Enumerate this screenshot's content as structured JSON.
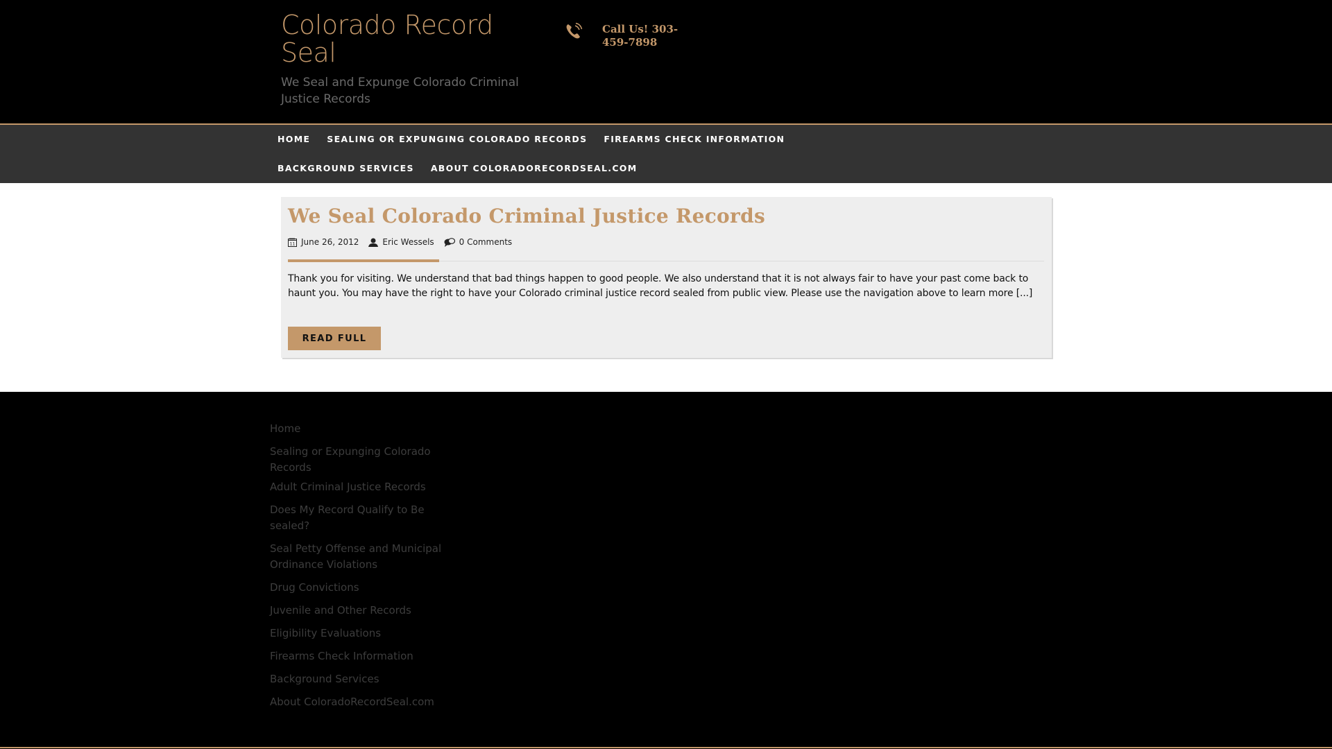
{
  "header": {
    "site_title": "Colorado Record Seal",
    "tagline": "We Seal and Expunge Colorado Criminal Justice Records",
    "phone_label": "Call Us! 303-459-7898",
    "phone_icon": "phone-icon"
  },
  "nav": {
    "items": [
      {
        "label": "Home"
      },
      {
        "label": "Sealing or Expunging Colorado Records"
      },
      {
        "label": "Firearms Check Information"
      },
      {
        "label": "Background Services"
      },
      {
        "label": "About ColoradoRecordSeal.com"
      }
    ]
  },
  "post": {
    "title": "We Seal Colorado Criminal Justice Records",
    "date": "June 26, 2012",
    "author": "Eric Wessels",
    "comments": "0 Comments",
    "excerpt": "Thank you for visiting. We understand that bad things happen to good people. We also understand that it is not always fair to have your past come back to haunt you. You may have the right to have your Colorado criminal justice record sealed from public view. Please use the navigation above to learn more [...]",
    "read_more_label": "Read Full"
  },
  "footer": {
    "links": [
      {
        "label": "Home"
      },
      {
        "label": "Sealing or Expunging Colorado Records"
      },
      {
        "label": "Adult Criminal Justice Records"
      },
      {
        "label": "Does My Record Qualify to Be sealed?"
      },
      {
        "label": "Seal Petty Offense and Municipal Ordinance Violations"
      },
      {
        "label": "Drug Convictions"
      },
      {
        "label": "Juvenile and Other Records"
      },
      {
        "label": "Eligibility Evaluations"
      },
      {
        "label": "Firearms Check Information"
      },
      {
        "label": "Background Services"
      },
      {
        "label": "About ColoradoRecordSeal.com"
      }
    ]
  },
  "colors": {
    "accent": "#c4986a",
    "header_bg": "#000000",
    "nav_bg": "#333333",
    "card_bg": "#eeeeee",
    "footer_text": "#3d3d3d"
  }
}
